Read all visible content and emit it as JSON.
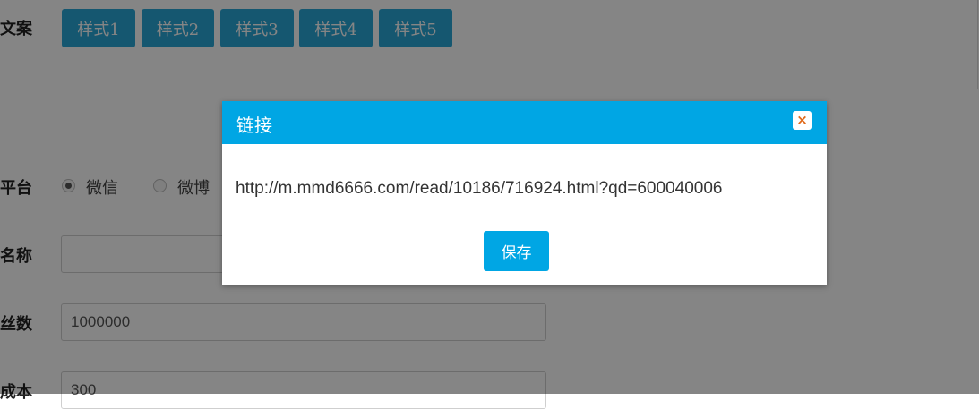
{
  "form": {
    "copy_label": "文案",
    "style_buttons": [
      "样式1",
      "样式2",
      "样式3",
      "样式4",
      "样式5"
    ],
    "platform_label": "平台",
    "platform_options": [
      {
        "label": "微信",
        "checked": true
      },
      {
        "label": "微博",
        "checked": false
      }
    ],
    "name_label": "名称",
    "name_value": "",
    "fans_label": "丝数",
    "fans_value": "1000000",
    "cost_label": "成本",
    "cost_value": "300"
  },
  "modal": {
    "title": "链接",
    "close_icon": "×",
    "link": "http://m.mmd6666.com/read/10186/716924.html?qd=600040006",
    "save_label": "保存"
  },
  "colors": {
    "primary": "#00a6e4",
    "style_button": "#2aa7d6",
    "close_icon": "#e06a1b"
  }
}
